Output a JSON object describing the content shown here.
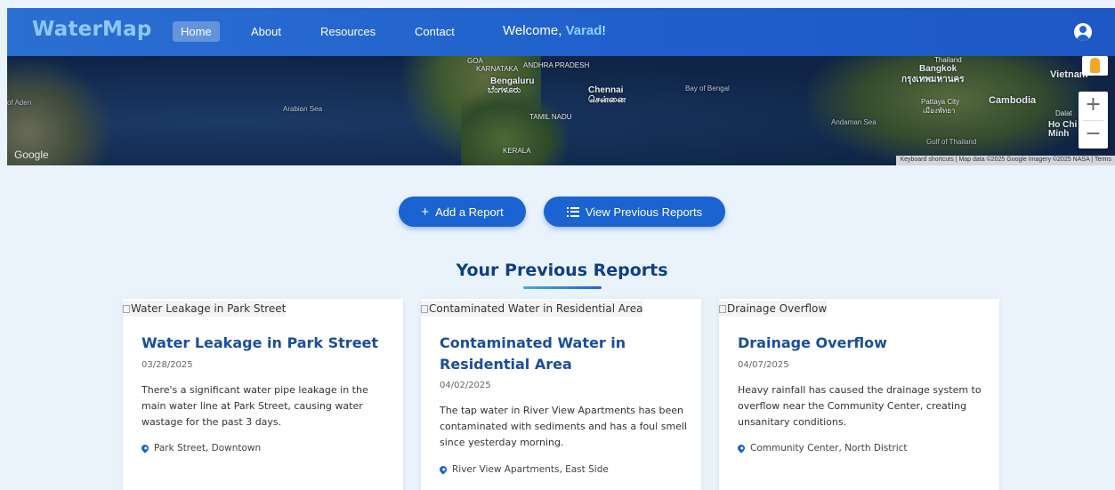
{
  "nav": {
    "brand": "WaterMap",
    "links": [
      "Home",
      "About",
      "Resources",
      "Contact"
    ],
    "welcome_prefix": "Welcome, ",
    "username": "Varad",
    "welcome_suffix": "!"
  },
  "map": {
    "labels": [
      "GOA",
      "KARNATAKA",
      "ANDHRA PRADESH",
      "Bengaluru",
      "ಬೆಂಗಳೂರು",
      "Chennai",
      "சென்னை",
      "TAMIL NADU",
      "KERALA",
      "Bay of Bengal",
      "Arabian Sea",
      "of Aden",
      "Bangkok",
      "กรุงเทพมหานคร",
      "Cambodia",
      "Pattaya City",
      "เมืองพัทยา",
      "Andaman Sea",
      "Gulf of Thailand",
      "Vietnam",
      "Dalat",
      "Ho Chi Minh",
      "Thailand"
    ],
    "logo": "Google",
    "attribution": "Keyboard shortcuts  |  Map data ©2025 Google Imagery ©2025 NASA  |  Terms",
    "zoom_in": "+",
    "zoom_out": "−"
  },
  "actions": {
    "add_report": "Add a Report",
    "view_reports": "View Previous Reports"
  },
  "section_title": "Your Previous Reports",
  "reports": [
    {
      "image_alt": "Water Leakage in Park Street",
      "title": "Water Leakage in Park Street",
      "date": "03/28/2025",
      "description": "There's a significant water pipe leakage in the main water line at Park Street, causing water wastage for the past 3 days.",
      "location": "Park Street, Downtown"
    },
    {
      "image_alt": "Contaminated Water in Residential Area",
      "title": "Contaminated Water in Residential Area",
      "date": "04/02/2025",
      "description": "The tap water in River View Apartments has been contaminated with sediments and has a foul smell since yesterday morning.",
      "location": "River View Apartments, East Side"
    },
    {
      "image_alt": "Drainage Overflow",
      "title": "Drainage Overflow",
      "date": "04/07/2025",
      "description": "Heavy rainfall has caused the drainage system to overflow near the Community Center, creating unsanitary conditions.",
      "location": "Community Center, North District"
    }
  ]
}
